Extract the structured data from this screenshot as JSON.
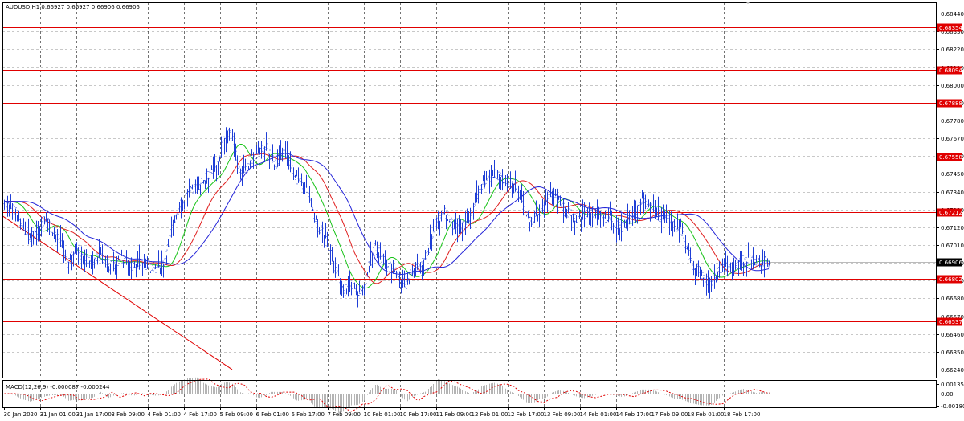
{
  "window": {
    "info_header": "AUDUSD,H1  0.66927 0.66927 0.66906 0.66906",
    "macd_label": "MACD(12,26,9) -0.000087 -0.000244"
  },
  "colors": {
    "background": "#ffffff",
    "grid": "#c8c8c8",
    "candles": "#1f3ed6",
    "ma_fast": "#19c319",
    "ma_mid": "#e02020",
    "ma_slow": "#2424d8",
    "level_line": "#e00000",
    "level_tag": "#e00000",
    "current_price_tag": "#000000",
    "macd_histogram": "#b4b4b4",
    "macd_signal": "#e00000",
    "trendline": "#e00000"
  },
  "chart_data": {
    "type": "candlestick",
    "symbol": "AUDUSD",
    "timeframe": "H1",
    "ohlc_header": [
      0.66927,
      0.66927,
      0.66906,
      0.66906
    ],
    "ylim": [
      0.6619,
      0.6851
    ],
    "y_ticks": [
      "0.68440",
      "0.68330",
      "0.68220",
      "0.68110",
      "0.68000",
      "0.67890",
      "0.67780",
      "0.67670",
      "0.67560",
      "0.67450",
      "0.67340",
      "0.67230",
      "0.67120",
      "0.67010",
      "0.66900",
      "0.66790",
      "0.66680",
      "0.66570",
      "0.66460",
      "0.66350",
      "0.66240"
    ],
    "x_ticks": [
      "30 Jan 2020",
      "31 Jan 01:00",
      "31 Jan 17:00",
      "3 Feb 09:00",
      "4 Feb 01:00",
      "4 Feb 17:00",
      "5 Feb 09:00",
      "6 Feb 01:00",
      "6 Feb 17:00",
      "7 Feb 09:00",
      "10 Feb 01:00",
      "10 Feb 17:00",
      "11 Feb 09:00",
      "12 Feb 01:00",
      "12 Feb 17:00",
      "13 Feb 09:00",
      "14 Feb 01:00",
      "14 Feb 17:00",
      "17 Feb 09:00",
      "18 Feb 01:00",
      "18 Feb 17:00"
    ],
    "horizontal_levels": [
      "0.68354",
      "0.68094",
      "0.67888",
      "0.67558",
      "0.67212",
      "0.66802",
      "0.66537"
    ],
    "current_price": "0.66906",
    "close_path": [
      [
        0,
        0.6728
      ],
      [
        12,
        0.6725
      ],
      [
        22,
        0.6712
      ],
      [
        32,
        0.6705
      ],
      [
        42,
        0.6712
      ],
      [
        52,
        0.6718
      ],
      [
        62,
        0.6708
      ],
      [
        72,
        0.67
      ],
      [
        80,
        0.669
      ],
      [
        90,
        0.67
      ],
      [
        100,
        0.6692
      ],
      [
        110,
        0.669
      ],
      [
        120,
        0.6695
      ],
      [
        130,
        0.6688
      ],
      [
        140,
        0.669
      ],
      [
        150,
        0.6693
      ],
      [
        160,
        0.6688
      ],
      [
        170,
        0.669
      ],
      [
        180,
        0.6688
      ],
      [
        190,
        0.6686
      ],
      [
        200,
        0.669
      ],
      [
        208,
        0.671
      ],
      [
        215,
        0.6722
      ],
      [
        225,
        0.673
      ],
      [
        235,
        0.6735
      ],
      [
        245,
        0.674
      ],
      [
        255,
        0.6745
      ],
      [
        265,
        0.6748
      ],
      [
        272,
        0.6765
      ],
      [
        278,
        0.677
      ],
      [
        285,
        0.6768
      ],
      [
        292,
        0.675
      ],
      [
        300,
        0.6745
      ],
      [
        310,
        0.6755
      ],
      [
        318,
        0.6758
      ],
      [
        325,
        0.6762
      ],
      [
        332,
        0.6755
      ],
      [
        340,
        0.675
      ],
      [
        348,
        0.6758
      ],
      [
        355,
        0.6752
      ],
      [
        362,
        0.6743
      ],
      [
        370,
        0.6738
      ],
      [
        378,
        0.6735
      ],
      [
        385,
        0.672
      ],
      [
        392,
        0.6712
      ],
      [
        400,
        0.6705
      ],
      [
        408,
        0.6695
      ],
      [
        416,
        0.668
      ],
      [
        424,
        0.6672
      ],
      [
        432,
        0.6678
      ],
      [
        440,
        0.6672
      ],
      [
        448,
        0.6675
      ],
      [
        455,
        0.669
      ],
      [
        462,
        0.67
      ],
      [
        470,
        0.6693
      ],
      [
        478,
        0.6688
      ],
      [
        486,
        0.6686
      ],
      [
        494,
        0.668
      ],
      [
        500,
        0.6676
      ],
      [
        508,
        0.6685
      ],
      [
        516,
        0.6688
      ],
      [
        524,
        0.6692
      ],
      [
        532,
        0.6705
      ],
      [
        540,
        0.6718
      ],
      [
        548,
        0.6722
      ],
      [
        556,
        0.6715
      ],
      [
        564,
        0.6712
      ],
      [
        572,
        0.6714
      ],
      [
        580,
        0.6718
      ],
      [
        586,
        0.6728
      ],
      [
        594,
        0.6738
      ],
      [
        602,
        0.674
      ],
      [
        610,
        0.6745
      ],
      [
        618,
        0.6743
      ],
      [
        626,
        0.6738
      ],
      [
        634,
        0.674
      ],
      [
        642,
        0.673
      ],
      [
        650,
        0.672
      ],
      [
        658,
        0.6715
      ],
      [
        666,
        0.6722
      ],
      [
        674,
        0.6728
      ],
      [
        682,
        0.6733
      ],
      [
        690,
        0.673
      ],
      [
        698,
        0.6722
      ],
      [
        706,
        0.672
      ],
      [
        714,
        0.6718
      ],
      [
        722,
        0.672
      ],
      [
        730,
        0.6722
      ],
      [
        738,
        0.672
      ],
      [
        746,
        0.6718
      ],
      [
        754,
        0.6716
      ],
      [
        762,
        0.6714
      ],
      [
        770,
        0.6712
      ],
      [
        778,
        0.6718
      ],
      [
        786,
        0.6723
      ],
      [
        794,
        0.6728
      ],
      [
        802,
        0.6726
      ],
      [
        810,
        0.672
      ],
      [
        818,
        0.6718
      ],
      [
        826,
        0.6717
      ],
      [
        834,
        0.6714
      ],
      [
        842,
        0.671
      ],
      [
        848,
        0.67
      ],
      [
        856,
        0.669
      ],
      [
        864,
        0.6685
      ],
      [
        872,
        0.668
      ],
      [
        880,
        0.6678
      ],
      [
        888,
        0.6684
      ],
      [
        896,
        0.6688
      ],
      [
        904,
        0.6686
      ],
      [
        912,
        0.6688
      ],
      [
        920,
        0.6692
      ],
      [
        928,
        0.6692
      ],
      [
        936,
        0.669
      ],
      [
        944,
        0.6691
      ],
      [
        952,
        0.66906
      ]
    ],
    "trendline": [
      [
        0,
        0.6719
      ],
      [
        286,
        0.6624
      ]
    ],
    "macd": {
      "label": "MACD(12,26,9) -0.000087 -0.000244",
      "params": [
        12,
        26,
        9
      ],
      "main": -8.7e-05,
      "signal": -0.000244,
      "ylim": [
        -0.002,
        0.002
      ],
      "y_ticks": [
        "0.001357",
        "0.00",
        "-0.001807"
      ]
    }
  }
}
